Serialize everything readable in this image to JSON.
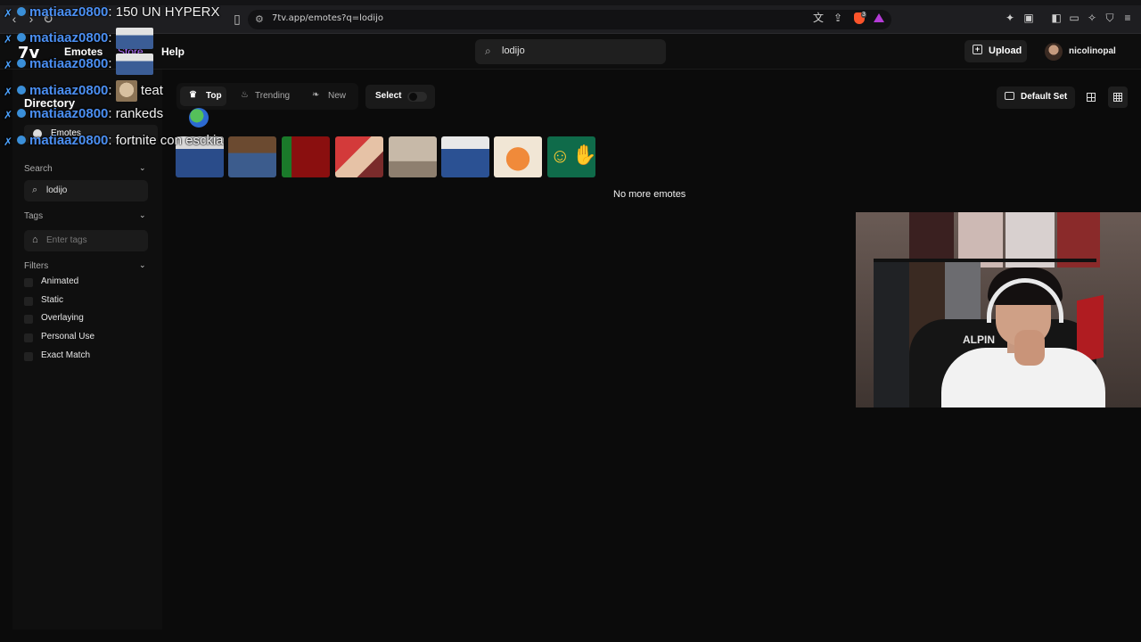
{
  "browser": {
    "url": "7tv.app/emotes?q=lodijo",
    "icons": [
      "back-icon",
      "forward-icon",
      "reload-icon",
      "bookmark-icon",
      "translate-icon",
      "share-icon",
      "brave-shield-icon",
      "rewards-icon",
      "extensions-icon",
      "sidebar-icon",
      "wallet-icon",
      "leo-icon",
      "vpn-icon",
      "menu-icon"
    ],
    "shield_count": "3"
  },
  "header": {
    "logo": "7v",
    "nav": [
      "Emotes",
      "Store",
      "Help"
    ],
    "search_value": "lodijo",
    "upload_label": "Upload",
    "username": "nicolinopal",
    "accent_store": "#b06cff"
  },
  "sidebar": {
    "title": "Directory",
    "section_item": "Emotes",
    "search_header": "Search",
    "search_value": "lodijo",
    "tags_header": "Tags",
    "tags_placeholder": "Enter tags",
    "filters_header": "Filters",
    "filters": [
      "Animated",
      "Static",
      "Overlaying",
      "Personal Use",
      "Exact Match"
    ]
  },
  "toolbar": {
    "sort_options": [
      "Top",
      "Trending",
      "New"
    ],
    "active_sort": "Top",
    "select_label": "Select",
    "select_on": false,
    "default_set_label": "Default Set"
  },
  "results": {
    "emote_count": 8,
    "end_message": "No more emotes"
  },
  "chat": {
    "user_color": "#4b8ff2",
    "lines": [
      {
        "user": "matiaaz0800",
        "sep": ":",
        "text": " 150 UN HYPERX"
      },
      {
        "user": "matiaaz0800",
        "sep": ":",
        "text": ""
      },
      {
        "user": "matiaaz0800",
        "sep": ":",
        "text": ""
      },
      {
        "user": "matiaaz0800",
        "sep": ":",
        "text": " teat"
      },
      {
        "user": "matiaaz0800",
        "sep": ":",
        "text": " rankeds"
      },
      {
        "user": "matiaaz0800",
        "sep": ":",
        "text": " fortnite con esckia"
      }
    ]
  },
  "webcam": {
    "shirt_text": "ALPIN"
  }
}
